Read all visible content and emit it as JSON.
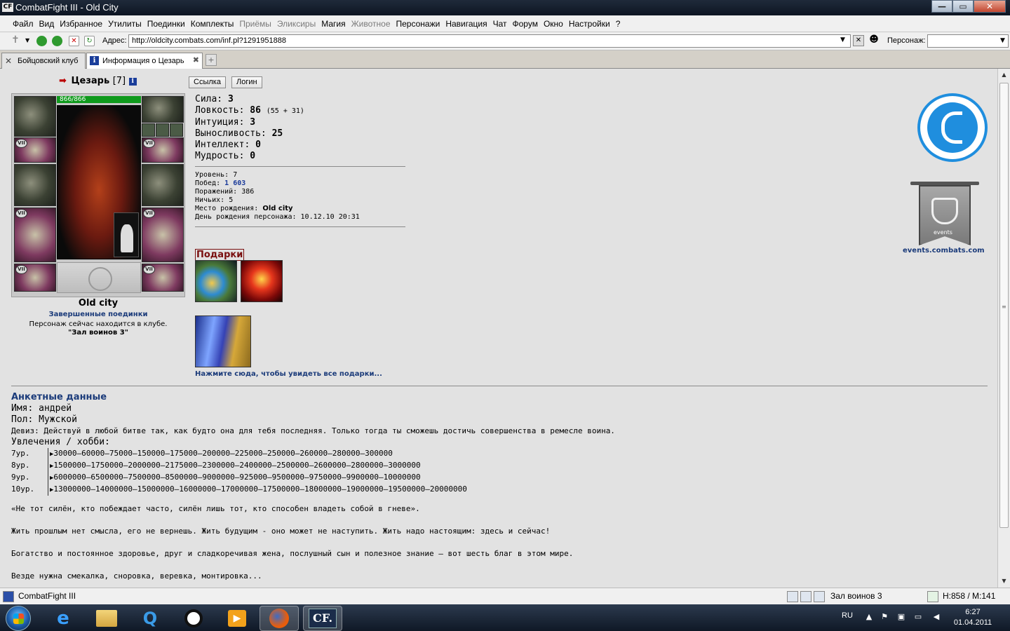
{
  "window": {
    "app_icon": "CF",
    "title": "CombatFight III - Old City",
    "buttons": {
      "minimize": "—",
      "maximize": "▭",
      "close": "✕"
    }
  },
  "menu": [
    {
      "label": "Файл",
      "enabled": true
    },
    {
      "label": "Вид",
      "enabled": true
    },
    {
      "label": "Избранное",
      "enabled": true
    },
    {
      "label": "Утилиты",
      "enabled": true
    },
    {
      "label": "Поединки",
      "enabled": true
    },
    {
      "label": "Комплекты",
      "enabled": true
    },
    {
      "label": "Приёмы",
      "enabled": false
    },
    {
      "label": "Эликсиры",
      "enabled": false
    },
    {
      "label": "Магия",
      "enabled": true
    },
    {
      "label": "Животное",
      "enabled": false
    },
    {
      "label": "Персонажи",
      "enabled": true
    },
    {
      "label": "Навигация",
      "enabled": true
    },
    {
      "label": "Чат",
      "enabled": true
    },
    {
      "label": "Форум",
      "enabled": true
    },
    {
      "label": "Окно",
      "enabled": true
    },
    {
      "label": "Настройки",
      "enabled": true
    },
    {
      "label": "?",
      "enabled": true
    }
  ],
  "address": {
    "label": "Адрес:",
    "url": "http://oldcity.combats.com/inf.pl?1291951888",
    "character_label": "Персонаж:",
    "character_value": ""
  },
  "tabs": [
    {
      "label": "Бойцовский клуб",
      "active": false
    },
    {
      "label": "Информация о Цезарь",
      "active": true
    }
  ],
  "character": {
    "name": "Цезарь",
    "level": "[7]",
    "hp": "866/866",
    "city": "Old city",
    "battles_link": "Завершенные поединки",
    "club_text": "Персонаж сейчас находится в клубе.",
    "club_room": "\"Зал воинов 3\"",
    "buttons": {
      "link": "Ссылка",
      "login": "Логин"
    },
    "slot_tag": "VII"
  },
  "stats": [
    {
      "label": "Сила:",
      "value": "3",
      "extra": ""
    },
    {
      "label": "Ловкость:",
      "value": "86",
      "extra": "(55 + 31)"
    },
    {
      "label": "Интуиция:",
      "value": "3",
      "extra": ""
    },
    {
      "label": "Выносливость:",
      "value": "25",
      "extra": ""
    },
    {
      "label": "Интеллект:",
      "value": "0",
      "extra": ""
    },
    {
      "label": "Мудрость:",
      "value": "0",
      "extra": ""
    }
  ],
  "info": {
    "level_label": "Уровень:",
    "level": "7",
    "wins_label": "Побед:",
    "wins": "1 603",
    "losses_label": "Поражений:",
    "losses": "386",
    "draws_label": "Ничьих:",
    "draws": "5",
    "birthplace_label": "Место рождения:",
    "birthplace": "Old city",
    "birthday_label": "День рождения персонажа:",
    "birthday": "10.12.10 20:31"
  },
  "gifts": {
    "title": "Подарки",
    "link": "Нажмите сюда, чтобы увидеть все подарки..."
  },
  "side": {
    "events_text": "events",
    "events_link": "events.combats.com"
  },
  "profile": {
    "title": "Анкетные данные",
    "name_line": "Имя: андрей",
    "sex_line": "Пол: Мужской",
    "motto_line": "Девиз: Действуй в любой битве так, как будто она для тебя последняя. Только тогда ты сможешь достичь совершенства в ремесле воина.",
    "hobby_label": "Увлечения / хобби:",
    "hobby_rows": [
      {
        "level": "7ур.",
        "text": "30000–60000–75000–150000–175000–200000–225000–250000–260000–280000–300000"
      },
      {
        "level": "8ур.",
        "text": "1500000–1750000–2000000–2175000–2300000–2400000–2500000–2600000–2800000–3000000"
      },
      {
        "level": "9ур.",
        "text": "6000000–6500000–7500000–8500000–9000000–925000–9500000–9750000–9900000–10000000"
      },
      {
        "level": "10ур.",
        "text": "13000000–14000000–15000000–16000000–17000000–17500000–18000000–19000000–19500000–20000000"
      }
    ],
    "quotes": [
      "«Не тот силён, кто побеждает часто, силён лишь тот, кто способен владеть собой в гневе».",
      "Жить прошлым нет смысла, его не вернешь. Жить будущим - оно может не наступить. Жить надо настоящим: здесь и сейчас!",
      "Богатство и постоянное здоровье, друг и сладкоречивая жена, послушный сын и полезное знание — вот шесть благ в этом мире.",
      "Везде нужна смекалка, сноровка, веревка, монтировка..."
    ]
  },
  "statusbar": {
    "app": "CombatFight III",
    "location": "Зал воинов 3",
    "hp_mana": "H:858 / M:141"
  },
  "taskbar": {
    "cf_label": "CF.",
    "lang": "RU",
    "time": "6:27",
    "date": "01.04.2011"
  },
  "colors": {
    "link_blue": "#1b3b7a",
    "hp_green": "#0f9a1c",
    "gift_title": "#7a1010",
    "logo_blue": "#1f8ede"
  }
}
